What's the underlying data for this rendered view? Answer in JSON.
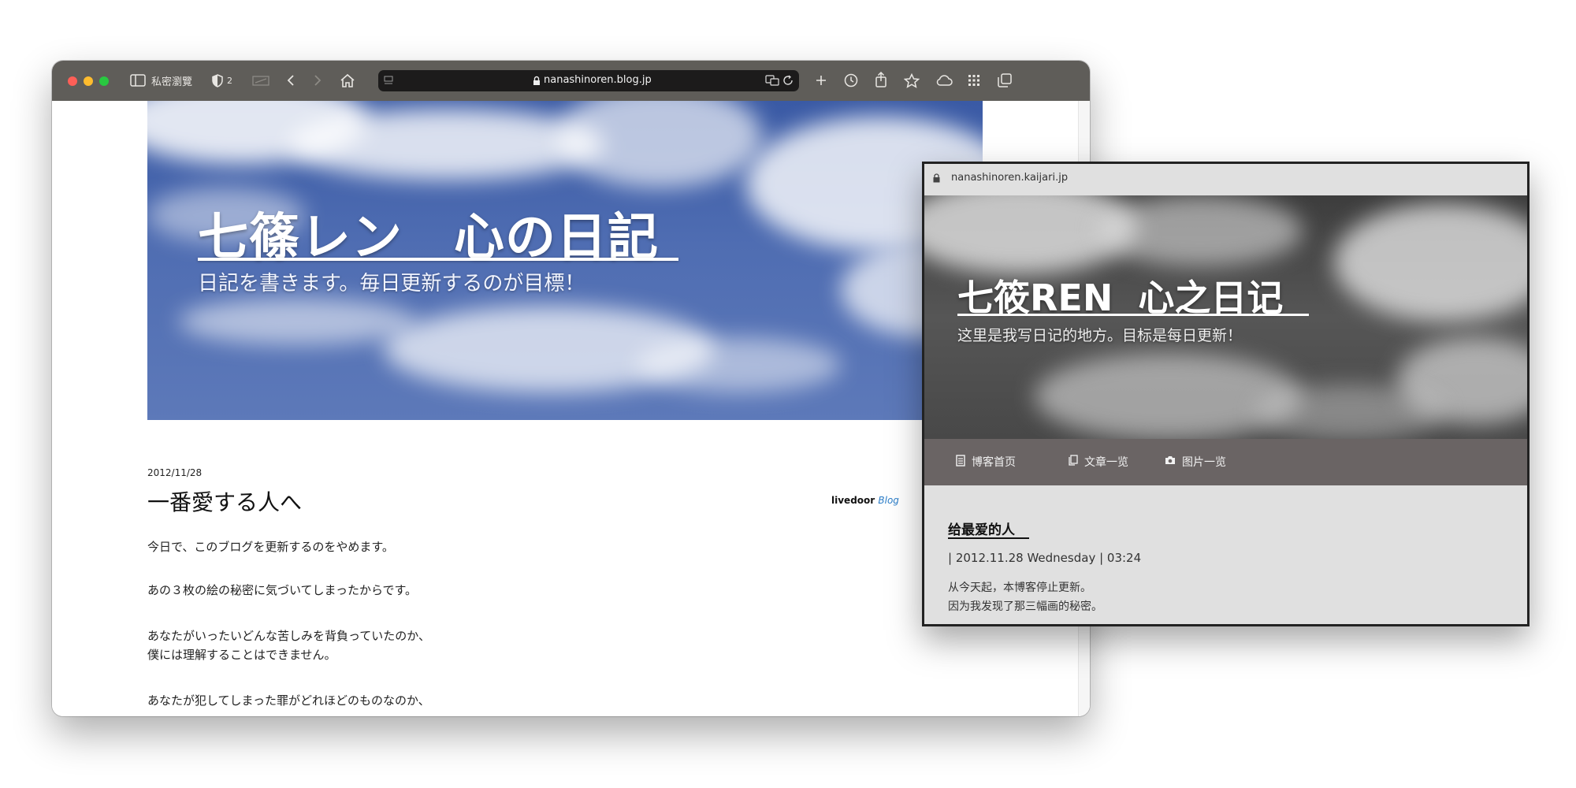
{
  "main_browser": {
    "toolbar": {
      "private_browsing_label": "私密瀏覽",
      "shield_count": "2",
      "url": "nanashinoren.blog.jp"
    },
    "hero": {
      "title": "七篠レン　心の日記",
      "subtitle": "日記を書きます。毎日更新するのが目標！"
    },
    "post": {
      "date": "2012/11/28",
      "title": "一番愛する人へ",
      "paragraphs": [
        "今日で、このブログを更新するのをやめます。",
        "あの３枚の絵の秘密に気づいてしまったからです。",
        "あなたがいったいどんな苦しみを背負っていたのか、",
        "僕には理解することはできません。",
        "あなたが犯してしまった罪がどれほどのものなのか、"
      ]
    },
    "livedoor": {
      "brand": "livedoor",
      "blog": "Blog"
    }
  },
  "inset_browser": {
    "url": "nanashinoren.kaijari.jp",
    "hero": {
      "title": "七筱REN  心之日记",
      "subtitle": "这里是我写日记的地方。目标是每日更新！"
    },
    "nav": [
      "博客首页",
      "文章一览",
      "图片一览"
    ],
    "post": {
      "title": "给最爱的人",
      "meta": "| 2012.11.28 Wednesday | 03:24",
      "lines": [
        "从今天起，本博客停止更新。",
        "因为我发现了那三幅画的秘密。"
      ]
    }
  },
  "colors": {
    "toolbar": "#5f5d59",
    "sky_blue": "#4f6db2",
    "link_blue": "#2a7cc7",
    "inset_nav": "#6a6464",
    "inset_bg": "#e0e0e0"
  },
  "icons": [
    "sidebar-icon",
    "shield-icon",
    "tab-overview-icon",
    "back-icon",
    "forward-icon",
    "home-icon",
    "lock-icon",
    "translate-icon",
    "reload-icon",
    "new-tab-icon",
    "history-icon",
    "share-icon",
    "bookmark-star-icon",
    "cloud-icon",
    "grid-icon",
    "tabs-icon"
  ]
}
